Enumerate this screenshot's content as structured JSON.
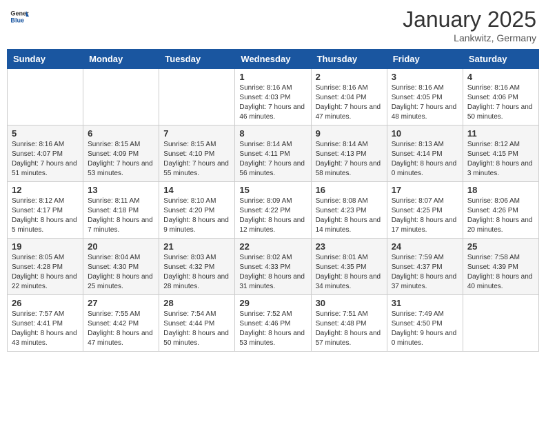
{
  "logo": {
    "text_general": "General",
    "text_blue": "Blue"
  },
  "title": "January 2025",
  "location": "Lankwitz, Germany",
  "days_of_week": [
    "Sunday",
    "Monday",
    "Tuesday",
    "Wednesday",
    "Thursday",
    "Friday",
    "Saturday"
  ],
  "weeks": [
    [
      {
        "day": "",
        "info": ""
      },
      {
        "day": "",
        "info": ""
      },
      {
        "day": "",
        "info": ""
      },
      {
        "day": "1",
        "info": "Sunrise: 8:16 AM\nSunset: 4:03 PM\nDaylight: 7 hours and 46 minutes."
      },
      {
        "day": "2",
        "info": "Sunrise: 8:16 AM\nSunset: 4:04 PM\nDaylight: 7 hours and 47 minutes."
      },
      {
        "day": "3",
        "info": "Sunrise: 8:16 AM\nSunset: 4:05 PM\nDaylight: 7 hours and 48 minutes."
      },
      {
        "day": "4",
        "info": "Sunrise: 8:16 AM\nSunset: 4:06 PM\nDaylight: 7 hours and 50 minutes."
      }
    ],
    [
      {
        "day": "5",
        "info": "Sunrise: 8:16 AM\nSunset: 4:07 PM\nDaylight: 7 hours and 51 minutes."
      },
      {
        "day": "6",
        "info": "Sunrise: 8:15 AM\nSunset: 4:09 PM\nDaylight: 7 hours and 53 minutes."
      },
      {
        "day": "7",
        "info": "Sunrise: 8:15 AM\nSunset: 4:10 PM\nDaylight: 7 hours and 55 minutes."
      },
      {
        "day": "8",
        "info": "Sunrise: 8:14 AM\nSunset: 4:11 PM\nDaylight: 7 hours and 56 minutes."
      },
      {
        "day": "9",
        "info": "Sunrise: 8:14 AM\nSunset: 4:13 PM\nDaylight: 7 hours and 58 minutes."
      },
      {
        "day": "10",
        "info": "Sunrise: 8:13 AM\nSunset: 4:14 PM\nDaylight: 8 hours and 0 minutes."
      },
      {
        "day": "11",
        "info": "Sunrise: 8:12 AM\nSunset: 4:15 PM\nDaylight: 8 hours and 3 minutes."
      }
    ],
    [
      {
        "day": "12",
        "info": "Sunrise: 8:12 AM\nSunset: 4:17 PM\nDaylight: 8 hours and 5 minutes."
      },
      {
        "day": "13",
        "info": "Sunrise: 8:11 AM\nSunset: 4:18 PM\nDaylight: 8 hours and 7 minutes."
      },
      {
        "day": "14",
        "info": "Sunrise: 8:10 AM\nSunset: 4:20 PM\nDaylight: 8 hours and 9 minutes."
      },
      {
        "day": "15",
        "info": "Sunrise: 8:09 AM\nSunset: 4:22 PM\nDaylight: 8 hours and 12 minutes."
      },
      {
        "day": "16",
        "info": "Sunrise: 8:08 AM\nSunset: 4:23 PM\nDaylight: 8 hours and 14 minutes."
      },
      {
        "day": "17",
        "info": "Sunrise: 8:07 AM\nSunset: 4:25 PM\nDaylight: 8 hours and 17 minutes."
      },
      {
        "day": "18",
        "info": "Sunrise: 8:06 AM\nSunset: 4:26 PM\nDaylight: 8 hours and 20 minutes."
      }
    ],
    [
      {
        "day": "19",
        "info": "Sunrise: 8:05 AM\nSunset: 4:28 PM\nDaylight: 8 hours and 22 minutes."
      },
      {
        "day": "20",
        "info": "Sunrise: 8:04 AM\nSunset: 4:30 PM\nDaylight: 8 hours and 25 minutes."
      },
      {
        "day": "21",
        "info": "Sunrise: 8:03 AM\nSunset: 4:32 PM\nDaylight: 8 hours and 28 minutes."
      },
      {
        "day": "22",
        "info": "Sunrise: 8:02 AM\nSunset: 4:33 PM\nDaylight: 8 hours and 31 minutes."
      },
      {
        "day": "23",
        "info": "Sunrise: 8:01 AM\nSunset: 4:35 PM\nDaylight: 8 hours and 34 minutes."
      },
      {
        "day": "24",
        "info": "Sunrise: 7:59 AM\nSunset: 4:37 PM\nDaylight: 8 hours and 37 minutes."
      },
      {
        "day": "25",
        "info": "Sunrise: 7:58 AM\nSunset: 4:39 PM\nDaylight: 8 hours and 40 minutes."
      }
    ],
    [
      {
        "day": "26",
        "info": "Sunrise: 7:57 AM\nSunset: 4:41 PM\nDaylight: 8 hours and 43 minutes."
      },
      {
        "day": "27",
        "info": "Sunrise: 7:55 AM\nSunset: 4:42 PM\nDaylight: 8 hours and 47 minutes."
      },
      {
        "day": "28",
        "info": "Sunrise: 7:54 AM\nSunset: 4:44 PM\nDaylight: 8 hours and 50 minutes."
      },
      {
        "day": "29",
        "info": "Sunrise: 7:52 AM\nSunset: 4:46 PM\nDaylight: 8 hours and 53 minutes."
      },
      {
        "day": "30",
        "info": "Sunrise: 7:51 AM\nSunset: 4:48 PM\nDaylight: 8 hours and 57 minutes."
      },
      {
        "day": "31",
        "info": "Sunrise: 7:49 AM\nSunset: 4:50 PM\nDaylight: 9 hours and 0 minutes."
      },
      {
        "day": "",
        "info": ""
      }
    ]
  ]
}
